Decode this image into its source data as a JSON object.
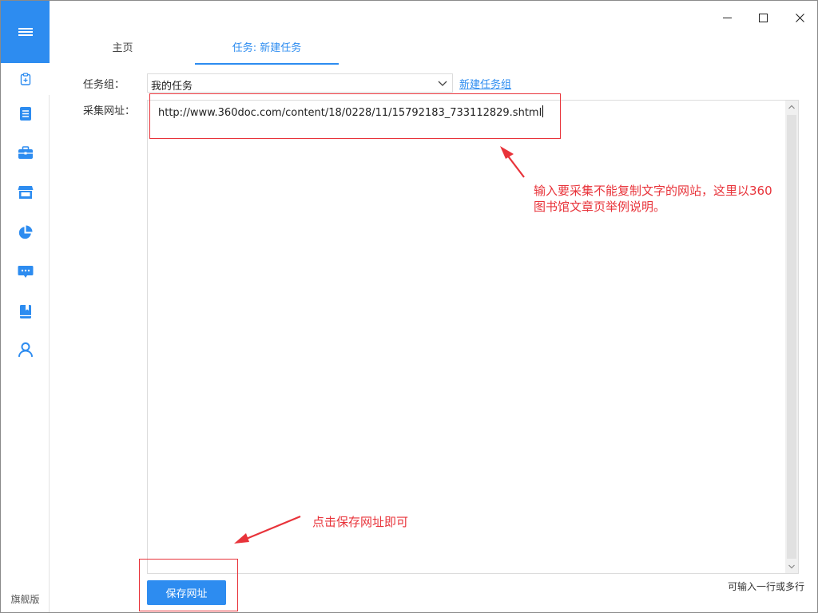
{
  "sidebar": {
    "menu_icon": "hamburger-icon",
    "items": [
      {
        "icon": "new-task-icon",
        "active": true
      },
      {
        "icon": "document-icon",
        "active": false
      },
      {
        "icon": "briefcase-icon",
        "active": false
      },
      {
        "icon": "store-icon",
        "active": false
      },
      {
        "icon": "pie-chart-icon",
        "active": false
      },
      {
        "icon": "chat-icon",
        "active": false
      },
      {
        "icon": "book-icon",
        "active": false
      },
      {
        "icon": "user-icon",
        "active": false
      }
    ],
    "edition": "旗舰版"
  },
  "window_controls": {
    "minimize_icon": "minimize-icon",
    "maximize_icon": "maximize-icon",
    "close_icon": "close-icon"
  },
  "tabs": [
    {
      "label": "主页",
      "active": false
    },
    {
      "label": "任务: 新建任务",
      "active": true
    }
  ],
  "form": {
    "task_group_label": "任务组：",
    "task_group_value": "我的任务",
    "new_group_link": "新建任务组",
    "url_label": "采集网址：",
    "url_value": "http://www.360doc.com/content/18/0228/11/15792183_733112829.shtml",
    "hint": "可输入一行或多行",
    "save_button": "保存网址"
  },
  "annotations": {
    "url_note_line1": "输入要采集不能复制文字的网站，这里以360",
    "url_note_line2": "图书馆文章页举例说明。",
    "save_note": "点击保存网址即可"
  },
  "colors": {
    "accent": "#2d8cf0",
    "annotation": "#e8333a"
  }
}
